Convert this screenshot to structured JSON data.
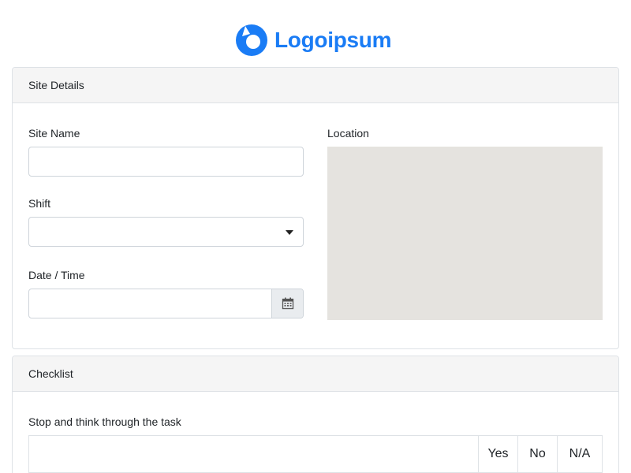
{
  "logo": {
    "text": "Logoipsum",
    "color": "#1a7cf5"
  },
  "site_details": {
    "title": "Site Details",
    "site_name": {
      "label": "Site Name",
      "value": ""
    },
    "shift": {
      "label": "Shift",
      "selected": ""
    },
    "datetime": {
      "label": "Date / Time",
      "value": "",
      "icon": "calendar-icon"
    },
    "location": {
      "label": "Location"
    }
  },
  "checklist": {
    "title": "Checklist",
    "items": [
      {
        "question": "Stop and think through the task",
        "options": [
          "Yes",
          "No",
          "N/A"
        ]
      }
    ]
  }
}
